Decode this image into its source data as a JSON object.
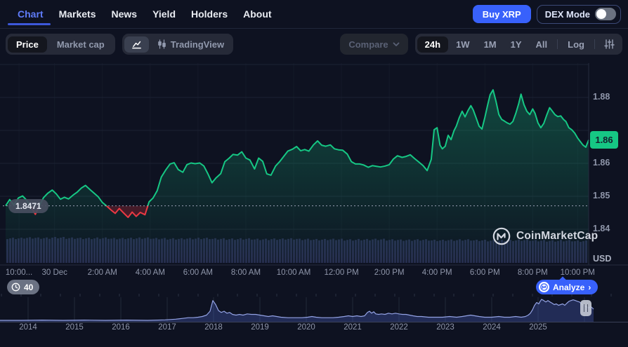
{
  "nav": {
    "tabs": [
      "Chart",
      "Markets",
      "News",
      "Yield",
      "Holders",
      "About"
    ],
    "active_tab": "Chart",
    "buy_button": "Buy XRP",
    "dex_mode_label": "DEX Mode",
    "dex_mode_on": false
  },
  "toolbar": {
    "metric_options": [
      "Price",
      "Market cap"
    ],
    "active_metric": "Price",
    "tradingview_label": "TradingView",
    "compare_label": "Compare",
    "ranges": [
      "24h",
      "1W",
      "1M",
      "1Y",
      "All"
    ],
    "active_range": "24h",
    "log_label": "Log"
  },
  "watermark": "CoinMarketCap",
  "analyze_button": "Analyze",
  "analyze_arrow": "›",
  "history_badge": "40",
  "currency_label": "USD",
  "colors": {
    "green": "#16c784",
    "red": "#ea3943",
    "blue": "#3861fb",
    "volume": "#262b4d",
    "navigator_line": "#93a2e4",
    "navigator_fill": "rgba(73,94,185,0.35)",
    "gridline": "#1c2233",
    "axis_line": "#252c3f"
  },
  "chart_data": {
    "type": "area",
    "main": {
      "title": "XRP price (24h, USD)",
      "current_price_label": "1.86",
      "open_price": 1.8471,
      "open_price_label": "1.8471",
      "y_axis_labels": [
        {
          "text": "1.88",
          "price": 1.88
        },
        {
          "text": "1.86",
          "price": 1.86
        },
        {
          "text": "1.85",
          "price": 1.85
        },
        {
          "text": "1.84",
          "price": 1.84
        }
      ],
      "gridline_prices": [
        1.89,
        1.88,
        1.87,
        1.86,
        1.85,
        1.84
      ],
      "x_ticks": [
        {
          "label": "10:00...",
          "f": 0.023
        },
        {
          "label": "30 Dec",
          "f": 0.084
        },
        {
          "label": "2:00 AM",
          "f": 0.166
        },
        {
          "label": "4:00 AM",
          "f": 0.248
        },
        {
          "label": "6:00 AM",
          "f": 0.33
        },
        {
          "label": "8:00 AM",
          "f": 0.412
        },
        {
          "label": "10:00 AM",
          "f": 0.494
        },
        {
          "label": "12:00 PM",
          "f": 0.576
        },
        {
          "label": "2:00 PM",
          "f": 0.658
        },
        {
          "label": "4:00 PM",
          "f": 0.74
        },
        {
          "label": "6:00 PM",
          "f": 0.822
        },
        {
          "label": "8:00 PM",
          "f": 0.904
        },
        {
          "label": "10:00 PM",
          "f": 0.981
        }
      ],
      "points": [
        [
          0.0,
          1.8471
        ],
        [
          0.007,
          1.849
        ],
        [
          0.014,
          1.8474
        ],
        [
          0.022,
          1.8495
        ],
        [
          0.029,
          1.8501
        ],
        [
          0.036,
          1.8488
        ],
        [
          0.043,
          1.847
        ],
        [
          0.051,
          1.8445
        ],
        [
          0.058,
          1.8472
        ],
        [
          0.065,
          1.8496
        ],
        [
          0.072,
          1.8509
        ],
        [
          0.08,
          1.8519
        ],
        [
          0.087,
          1.8507
        ],
        [
          0.094,
          1.8491
        ],
        [
          0.101,
          1.8497
        ],
        [
          0.108,
          1.8492
        ],
        [
          0.116,
          1.8504
        ],
        [
          0.123,
          1.8513
        ],
        [
          0.13,
          1.8525
        ],
        [
          0.137,
          1.8533
        ],
        [
          0.145,
          1.852
        ],
        [
          0.152,
          1.8509
        ],
        [
          0.159,
          1.8498
        ],
        [
          0.166,
          1.8481
        ],
        [
          0.173,
          1.8471
        ],
        [
          0.181,
          1.8458
        ],
        [
          0.188,
          1.8448
        ],
        [
          0.195,
          1.8463
        ],
        [
          0.202,
          1.845
        ],
        [
          0.21,
          1.8436
        ],
        [
          0.217,
          1.8452
        ],
        [
          0.224,
          1.8439
        ],
        [
          0.231,
          1.8451
        ],
        [
          0.239,
          1.8444
        ],
        [
          0.246,
          1.8483
        ],
        [
          0.253,
          1.8495
        ],
        [
          0.26,
          1.8517
        ],
        [
          0.267,
          1.8558
        ],
        [
          0.275,
          1.8581
        ],
        [
          0.282,
          1.8598
        ],
        [
          0.289,
          1.8602
        ],
        [
          0.296,
          1.8581
        ],
        [
          0.304,
          1.8573
        ],
        [
          0.311,
          1.8596
        ],
        [
          0.318,
          1.8601
        ],
        [
          0.325,
          1.8599
        ],
        [
          0.333,
          1.8601
        ],
        [
          0.34,
          1.8592
        ],
        [
          0.347,
          1.8568
        ],
        [
          0.354,
          1.8541
        ],
        [
          0.361,
          1.8556
        ],
        [
          0.369,
          1.8569
        ],
        [
          0.376,
          1.8605
        ],
        [
          0.383,
          1.8615
        ],
        [
          0.39,
          1.8627
        ],
        [
          0.398,
          1.8625
        ],
        [
          0.405,
          1.8635
        ],
        [
          0.412,
          1.8616
        ],
        [
          0.419,
          1.861
        ],
        [
          0.427,
          1.8583
        ],
        [
          0.434,
          1.8616
        ],
        [
          0.441,
          1.8606
        ],
        [
          0.448,
          1.8568
        ],
        [
          0.455,
          1.8564
        ],
        [
          0.463,
          1.8592
        ],
        [
          0.47,
          1.8605
        ],
        [
          0.477,
          1.8621
        ],
        [
          0.484,
          1.8637
        ],
        [
          0.492,
          1.8643
        ],
        [
          0.499,
          1.8651
        ],
        [
          0.506,
          1.8638
        ],
        [
          0.513,
          1.8642
        ],
        [
          0.52,
          1.8637
        ],
        [
          0.528,
          1.8656
        ],
        [
          0.535,
          1.8668
        ],
        [
          0.542,
          1.8655
        ],
        [
          0.549,
          1.8652
        ],
        [
          0.557,
          1.8656
        ],
        [
          0.564,
          1.8644
        ],
        [
          0.571,
          1.8641
        ],
        [
          0.578,
          1.864
        ],
        [
          0.586,
          1.8628
        ],
        [
          0.593,
          1.8605
        ],
        [
          0.6,
          1.8598
        ],
        [
          0.607,
          1.8598
        ],
        [
          0.614,
          1.8595
        ],
        [
          0.622,
          1.8588
        ],
        [
          0.629,
          1.8593
        ],
        [
          0.636,
          1.8591
        ],
        [
          0.643,
          1.8589
        ],
        [
          0.651,
          1.8592
        ],
        [
          0.658,
          1.8596
        ],
        [
          0.665,
          1.8613
        ],
        [
          0.672,
          1.8623
        ],
        [
          0.68,
          1.8618
        ],
        [
          0.687,
          1.8621
        ],
        [
          0.694,
          1.8626
        ],
        [
          0.701,
          1.8615
        ],
        [
          0.708,
          1.8605
        ],
        [
          0.716,
          1.8593
        ],
        [
          0.723,
          1.8578
        ],
        [
          0.73,
          1.8612
        ],
        [
          0.735,
          1.8702
        ],
        [
          0.74,
          1.8708
        ],
        [
          0.745,
          1.8655
        ],
        [
          0.749,
          1.8644
        ],
        [
          0.754,
          1.8652
        ],
        [
          0.759,
          1.8685
        ],
        [
          0.764,
          1.8672
        ],
        [
          0.769,
          1.8699
        ],
        [
          0.773,
          1.8713
        ],
        [
          0.778,
          1.8738
        ],
        [
          0.783,
          1.8758
        ],
        [
          0.788,
          1.8741
        ],
        [
          0.793,
          1.876
        ],
        [
          0.798,
          1.8775
        ],
        [
          0.802,
          1.8762
        ],
        [
          0.807,
          1.8738
        ],
        [
          0.812,
          1.8713
        ],
        [
          0.817,
          1.8704
        ],
        [
          0.822,
          1.874
        ],
        [
          0.827,
          1.8779
        ],
        [
          0.831,
          1.8808
        ],
        [
          0.836,
          1.8823
        ],
        [
          0.841,
          1.8789
        ],
        [
          0.846,
          1.8748
        ],
        [
          0.851,
          1.8733
        ],
        [
          0.855,
          1.8729
        ],
        [
          0.86,
          1.8723
        ],
        [
          0.865,
          1.8719
        ],
        [
          0.87,
          1.8727
        ],
        [
          0.875,
          1.8752
        ],
        [
          0.88,
          1.8781
        ],
        [
          0.884,
          1.881
        ],
        [
          0.889,
          1.8778
        ],
        [
          0.894,
          1.8758
        ],
        [
          0.899,
          1.8748
        ],
        [
          0.904,
          1.8765
        ],
        [
          0.908,
          1.8752
        ],
        [
          0.913,
          1.8723
        ],
        [
          0.918,
          1.8708
        ],
        [
          0.923,
          1.8721
        ],
        [
          0.928,
          1.8746
        ],
        [
          0.933,
          1.8769
        ],
        [
          0.937,
          1.876
        ],
        [
          0.942,
          1.8748
        ],
        [
          0.947,
          1.8742
        ],
        [
          0.952,
          1.8744
        ],
        [
          0.957,
          1.8733
        ],
        [
          0.961,
          1.8727
        ],
        [
          0.966,
          1.8708
        ],
        [
          0.971,
          1.8702
        ],
        [
          0.976,
          1.8692
        ],
        [
          0.981,
          1.8677
        ],
        [
          0.986,
          1.8665
        ],
        [
          0.99,
          1.8656
        ],
        [
          0.995,
          1.8649
        ],
        [
          1.0,
          1.8671
        ]
      ],
      "volume_rel": [
        0.97,
        0.99,
        0.98,
        1.0,
        0.98,
        0.97,
        0.98,
        0.96,
        0.97,
        0.98,
        0.96,
        0.95,
        0.96,
        0.97,
        0.95,
        0.94,
        0.95,
        0.93,
        0.94,
        0.95,
        0.93,
        0.92,
        0.93,
        0.91,
        0.92,
        0.93,
        0.91,
        0.9,
        0.91,
        0.89,
        0.9,
        0.91,
        0.89,
        0.88,
        0.89,
        0.9,
        0.88,
        0.87,
        0.88,
        0.86
      ]
    },
    "navigator": {
      "years": [
        "2014",
        "2015",
        "2016",
        "2017",
        "2018",
        "2019",
        "2020",
        "2021",
        "2022",
        "2023",
        "2024",
        "2025"
      ],
      "points": [
        [
          0,
          0.06
        ],
        [
          30,
          0.06
        ],
        [
          60,
          0.07
        ],
        [
          90,
          0.06
        ],
        [
          120,
          0.07
        ],
        [
          150,
          0.06
        ],
        [
          180,
          0.07
        ],
        [
          210,
          0.06
        ],
        [
          235,
          0.08
        ],
        [
          250,
          0.11
        ],
        [
          260,
          0.14
        ],
        [
          268,
          0.17
        ],
        [
          275,
          0.17
        ],
        [
          282,
          0.19
        ],
        [
          288,
          0.22
        ],
        [
          294,
          0.28
        ],
        [
          299,
          0.44
        ],
        [
          303,
          0.89
        ],
        [
          307,
          0.72
        ],
        [
          311,
          0.47
        ],
        [
          315,
          0.39
        ],
        [
          319,
          0.44
        ],
        [
          323,
          0.36
        ],
        [
          327,
          0.39
        ],
        [
          331,
          0.31
        ],
        [
          336,
          0.28
        ],
        [
          341,
          0.31
        ],
        [
          346,
          0.28
        ],
        [
          352,
          0.33
        ],
        [
          358,
          0.31
        ],
        [
          364,
          0.31
        ],
        [
          370,
          0.28
        ],
        [
          376,
          0.25
        ],
        [
          382,
          0.22
        ],
        [
          388,
          0.25
        ],
        [
          394,
          0.22
        ],
        [
          400,
          0.19
        ],
        [
          410,
          0.17
        ],
        [
          420,
          0.17
        ],
        [
          430,
          0.17
        ],
        [
          438,
          0.19
        ],
        [
          444,
          0.22
        ],
        [
          450,
          0.19
        ],
        [
          458,
          0.17
        ],
        [
          466,
          0.17
        ],
        [
          474,
          0.17
        ],
        [
          482,
          0.19
        ],
        [
          490,
          0.22
        ],
        [
          496,
          0.25
        ],
        [
          502,
          0.22
        ],
        [
          508,
          0.25
        ],
        [
          514,
          0.22
        ],
        [
          519,
          0.25
        ],
        [
          523,
          0.39
        ],
        [
          526,
          0.44
        ],
        [
          529,
          0.36
        ],
        [
          532,
          0.42
        ],
        [
          535,
          0.33
        ],
        [
          539,
          0.31
        ],
        [
          543,
          0.33
        ],
        [
          548,
          0.31
        ],
        [
          553,
          0.36
        ],
        [
          558,
          0.33
        ],
        [
          563,
          0.36
        ],
        [
          568,
          0.33
        ],
        [
          573,
          0.31
        ],
        [
          578,
          0.31
        ],
        [
          583,
          0.28
        ],
        [
          588,
          0.25
        ],
        [
          594,
          0.22
        ],
        [
          600,
          0.22
        ],
        [
          610,
          0.19
        ],
        [
          620,
          0.19
        ],
        [
          630,
          0.19
        ],
        [
          640,
          0.22
        ],
        [
          650,
          0.19
        ],
        [
          658,
          0.22
        ],
        [
          664,
          0.25
        ],
        [
          670,
          0.28
        ],
        [
          676,
          0.25
        ],
        [
          682,
          0.22
        ],
        [
          690,
          0.19
        ],
        [
          700,
          0.19
        ],
        [
          710,
          0.22
        ],
        [
          718,
          0.19
        ],
        [
          726,
          0.19
        ],
        [
          734,
          0.22
        ],
        [
          742,
          0.19
        ],
        [
          748,
          0.22
        ],
        [
          752,
          0.28
        ],
        [
          755,
          0.36
        ],
        [
          758,
          0.5
        ],
        [
          761,
          0.69
        ],
        [
          764,
          0.81
        ],
        [
          767,
          0.75
        ],
        [
          769,
          0.86
        ],
        [
          771,
          0.94
        ],
        [
          774,
          0.89
        ],
        [
          777,
          0.83
        ],
        [
          780,
          0.89
        ],
        [
          783,
          0.83
        ],
        [
          786,
          0.78
        ],
        [
          789,
          0.72
        ],
        [
          792,
          0.75
        ],
        [
          795,
          0.69
        ],
        [
          798,
          0.72
        ],
        [
          801,
          0.75
        ],
        [
          804,
          0.69
        ],
        [
          807,
          0.78
        ],
        [
          810,
          0.86
        ],
        [
          813,
          0.89
        ],
        [
          816,
          0.92
        ],
        [
          819,
          0.89
        ],
        [
          822,
          0.86
        ],
        [
          825,
          0.83
        ],
        [
          828,
          0.75
        ],
        [
          831,
          0.69
        ],
        [
          834,
          0.64
        ],
        [
          838,
          0.58
        ],
        [
          841,
          0.64
        ],
        [
          845,
          0.53
        ]
      ]
    }
  }
}
